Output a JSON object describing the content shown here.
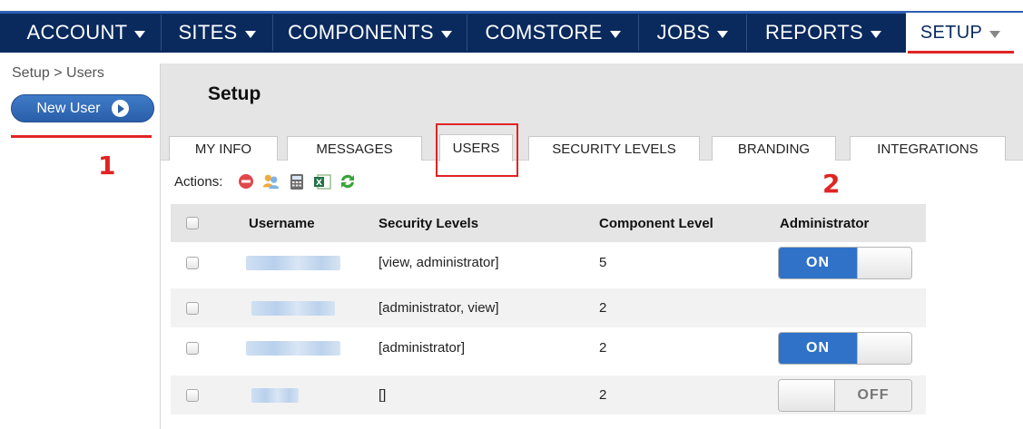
{
  "nav": {
    "items": [
      {
        "label": "ACCOUNT"
      },
      {
        "label": "SITES"
      },
      {
        "label": "COMPONENTS"
      },
      {
        "label": "COMSTORE"
      },
      {
        "label": "JOBS"
      },
      {
        "label": "REPORTS"
      },
      {
        "label": "SETUP",
        "active": true
      }
    ]
  },
  "sidebar": {
    "breadcrumb": "Setup > Users",
    "new_user_label": "New User"
  },
  "annotations": {
    "marker_1": "1",
    "marker_2": "2"
  },
  "main": {
    "title": "Setup",
    "tabs": [
      {
        "label": "MY INFO"
      },
      {
        "label": "MESSAGES"
      },
      {
        "label": "USERS",
        "active": true
      },
      {
        "label": "SECURITY LEVELS"
      },
      {
        "label": "BRANDING"
      },
      {
        "label": "INTEGRATIONS"
      }
    ],
    "actions_label": "Actions:",
    "action_icons": [
      "delete-icon",
      "users-icon",
      "calculator-icon",
      "excel-export-icon",
      "refresh-icon"
    ]
  },
  "table": {
    "headers": {
      "username": "Username",
      "security_levels": "Security Levels",
      "component_level": "Component Level",
      "administrator": "Administrator"
    },
    "rows": [
      {
        "security_levels": "[view, administrator]",
        "component_level": "5",
        "administrator": "ON"
      },
      {
        "security_levels": "[administrator, view]",
        "component_level": "2",
        "administrator": ""
      },
      {
        "security_levels": "[administrator]",
        "component_level": "2",
        "administrator": "ON"
      },
      {
        "security_levels": "[]",
        "component_level": "2",
        "administrator": "OFF"
      }
    ]
  },
  "colors": {
    "nav_bg": "#0a2a5e",
    "accent": "#2f72c8",
    "highlight": "#e02424"
  }
}
